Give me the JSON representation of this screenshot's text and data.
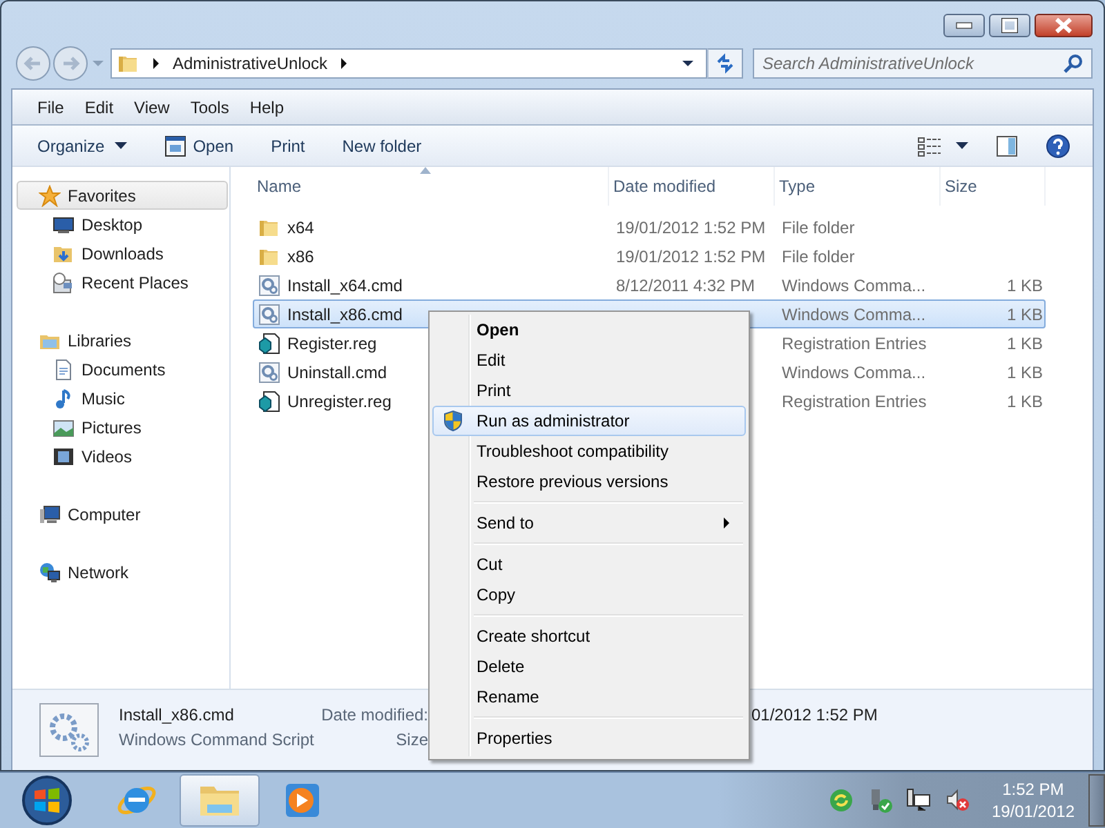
{
  "address": {
    "path": [
      "AdministrativeUnlock"
    ]
  },
  "search": {
    "placeholder": "Search AdministrativeUnlock"
  },
  "menu_bar": [
    "File",
    "Edit",
    "View",
    "Tools",
    "Help"
  ],
  "toolbar": [
    {
      "label": "Organize",
      "kind": "dropdown"
    },
    {
      "label": "Open",
      "kind": "icon"
    },
    {
      "label": "Print",
      "kind": "plain"
    },
    {
      "label": "New folder",
      "kind": "plain"
    }
  ],
  "sidebar": [
    {
      "label": "Favorites",
      "selected": true,
      "children": [
        {
          "label": "Desktop",
          "selected": false
        },
        {
          "label": "Downloads",
          "selected": false
        },
        {
          "label": "Recent Places",
          "selected": false
        }
      ]
    },
    {
      "label": "Libraries",
      "selected": false,
      "children": [
        {
          "label": "Documents",
          "selected": false
        },
        {
          "label": "Music",
          "selected": false
        },
        {
          "label": "Pictures",
          "selected": false
        },
        {
          "label": "Videos",
          "selected": false
        }
      ]
    },
    {
      "label": "Computer",
      "selected": false
    },
    {
      "label": "Network",
      "selected": false
    }
  ],
  "file_list": {
    "columns": [
      "Name",
      "Date modified",
      "Type",
      "Size"
    ],
    "rows": [
      {
        "name": "x64",
        "date": "19/01/2012 1:52 PM",
        "type": "File folder",
        "kind": "folder",
        "selected": false
      },
      {
        "name": "x86",
        "date": "19/01/2012 1:52 PM",
        "type": "File folder",
        "kind": "folder",
        "selected": false
      },
      {
        "name": "Install_x64.cmd",
        "date": "8/12/2011 4:32 PM",
        "type": "Windows Comma...",
        "size": "1 KB",
        "kind": "script",
        "selected": false
      },
      {
        "name": "Install_x86.cmd",
        "type": "Windows Comma...",
        "size": "1 KB",
        "kind": "script",
        "selected": true
      },
      {
        "name": "Register.reg",
        "type": "Registration Entries",
        "size": "1 KB",
        "kind": "registry",
        "selected": false
      },
      {
        "name": "Uninstall.cmd",
        "type": "Windows Comma...",
        "size": "1 KB",
        "kind": "script",
        "selected": false
      },
      {
        "name": "Unregister.reg",
        "type": "Registration Entries",
        "size": "1 KB",
        "kind": "registry",
        "selected": false
      }
    ]
  },
  "details": {
    "name": "Install_x86.cmd",
    "type": "Windows Command Script",
    "fields": [
      {
        "label": "Date modified:",
        "value": "01/2012 1:52 PM"
      },
      {
        "label": "Size"
      }
    ]
  },
  "context_menu": [
    [
      {
        "label": "Open",
        "default": true,
        "elevated": false,
        "submenu": false,
        "selected": false
      },
      {
        "label": "Edit",
        "default": false,
        "elevated": false,
        "submenu": false,
        "selected": false
      },
      {
        "label": "Print",
        "default": false,
        "elevated": false,
        "submenu": false,
        "selected": false
      },
      {
        "label": "Run as administrator",
        "default": false,
        "elevated": true,
        "submenu": false,
        "selected": true
      },
      {
        "label": "Troubleshoot compatibility",
        "default": false,
        "elevated": false,
        "submenu": false,
        "selected": false
      },
      {
        "label": "Restore previous versions",
        "default": false,
        "elevated": false,
        "submenu": false,
        "selected": false
      }
    ],
    [
      {
        "label": "Send to",
        "default": false,
        "elevated": false,
        "submenu": true,
        "selected": false
      }
    ],
    [
      {
        "label": "Cut",
        "default": false,
        "elevated": false,
        "submenu": false,
        "selected": false
      },
      {
        "label": "Copy",
        "default": false,
        "elevated": false,
        "submenu": false,
        "selected": false
      }
    ],
    [
      {
        "label": "Create shortcut",
        "default": false,
        "elevated": false,
        "submenu": false,
        "selected": false
      },
      {
        "label": "Delete",
        "default": false,
        "elevated": false,
        "submenu": false,
        "selected": false
      },
      {
        "label": "Rename",
        "default": false,
        "elevated": false,
        "submenu": false,
        "selected": false
      }
    ],
    [
      {
        "label": "Properties",
        "default": false,
        "elevated": false,
        "submenu": false,
        "selected": false
      }
    ]
  ],
  "taskbar": {
    "apps": [
      {
        "selected": false
      },
      {
        "selected": true
      },
      {
        "selected": false
      }
    ],
    "time": "1:52 PM",
    "date": "19/01/2012"
  }
}
